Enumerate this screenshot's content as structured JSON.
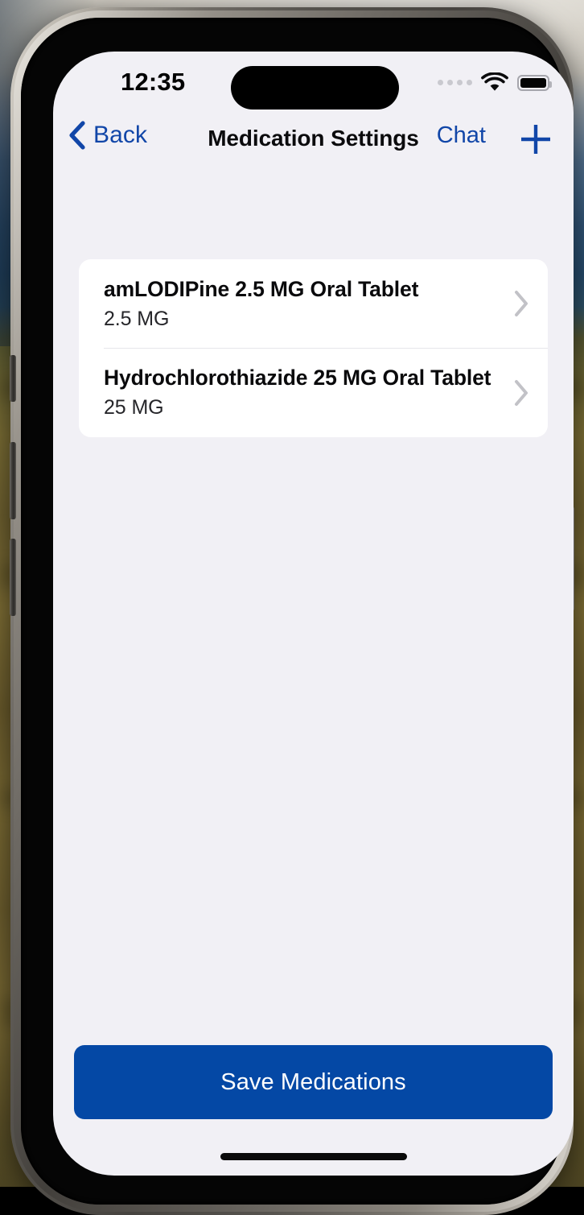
{
  "status_bar": {
    "time": "12:35",
    "cellular_icon": "cellular-dots-icon",
    "wifi_icon": "wifi-icon",
    "battery_icon": "battery-full-icon"
  },
  "nav_bar": {
    "back_label": "Back",
    "back_icon": "chevron-left-icon",
    "title": "Medication Settings",
    "chat_label": "Chat",
    "add_icon": "plus-icon"
  },
  "medications": [
    {
      "name": "amLODIPine 2.5 MG Oral Tablet",
      "dose": "2.5 MG",
      "disclosure_icon": "chevron-right-icon"
    },
    {
      "name": "Hydrochlorothiazide 25 MG Oral Tablet",
      "dose": "25 MG",
      "disclosure_icon": "chevron-right-icon"
    }
  ],
  "footer": {
    "save_label": "Save Medications"
  },
  "colors": {
    "accent_link": "#1146a8",
    "primary_button": "#0448a5",
    "screen_background": "#f1f0f5",
    "card_background": "#ffffff",
    "chevron": "#c2c2c7"
  }
}
